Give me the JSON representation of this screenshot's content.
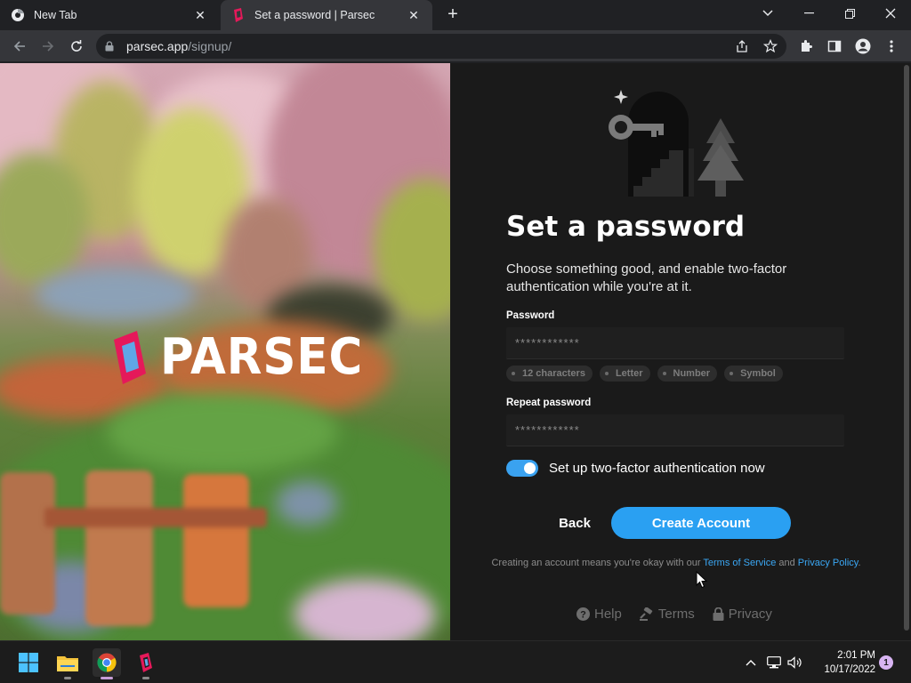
{
  "browser": {
    "tabs": [
      {
        "title": "New Tab",
        "active": false
      },
      {
        "title": "Set a password | Parsec",
        "active": true
      }
    ],
    "url_host": "parsec.app",
    "url_path": "/signup/"
  },
  "hero": {
    "logo_text": "PARSEC",
    "logo_color": "#e5195a"
  },
  "form": {
    "heading": "Set a password",
    "subtitle": "Choose something good, and enable two-factor authentication while you're at it.",
    "password_label": "Password",
    "password_value": "************",
    "requirements": [
      "12 characters",
      "Letter",
      "Number",
      "Symbol"
    ],
    "repeat_label": "Repeat password",
    "repeat_value": "************",
    "two_factor_label": "Set up two-factor authentication now",
    "two_factor_enabled": true,
    "back_label": "Back",
    "create_label": "Create Account",
    "legal_prefix": "Creating an account means you're okay with our ",
    "terms_link": "Terms of Service",
    "legal_and": " and ",
    "privacy_link": "Privacy Policy",
    "legal_suffix": ".",
    "accent_color": "#2aa0f2"
  },
  "footer": {
    "help": "Help",
    "terms": "Terms",
    "privacy": "Privacy"
  },
  "taskbar": {
    "time": "2:01 PM",
    "date": "10/17/2022",
    "notifications": "1"
  }
}
